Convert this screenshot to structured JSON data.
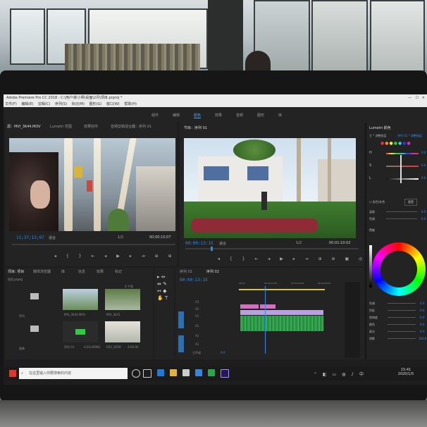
{
  "app": {
    "title_bar": "Adobe Premiere Pro CC 2018 - C:\\用户\\新小明\\桌面\\2月\\项目.prproj *",
    "menu": [
      "文件(F)",
      "编辑(E)",
      "剪辑(C)",
      "序列(S)",
      "标记(M)",
      "图形(G)",
      "窗口(W)",
      "帮助(H)"
    ]
  },
  "workspaces": [
    "组件",
    "编辑",
    "颜色",
    "效果",
    "音频",
    "图形",
    "库"
  ],
  "active_workspace": "颜色",
  "source_monitor": {
    "tabs": [
      "源：MVI_3644.MOV",
      "Lumetri 范围",
      "效果控件",
      "音频剪辑混合器：序列 01"
    ],
    "timecode": "11;37;13;07",
    "fit": "适合",
    "zoom": "1/2",
    "duration": "00;00;15;07"
  },
  "program_monitor": {
    "tab": "节目：序列 01",
    "timecode": "00:00:13:15",
    "fit": "适合",
    "zoom": "1/2",
    "duration": "00:01:10:02"
  },
  "project_panel": {
    "tabs": [
      "项目: 项目",
      "媒体浏览器",
      "库",
      "信息",
      "效果",
      "标记"
    ],
    "project_file": "项目.prproj",
    "item_count": "3 个项",
    "items": [
      {
        "name": "序列",
        "meta": ""
      },
      {
        "name": "MVI_3644.MOV",
        "meta": ""
      },
      {
        "name": "MVI_3641",
        "meta": ""
      },
      {
        "name": "图像",
        "meta": ""
      },
      {
        "name": "序列 01",
        "meta": "4;20;40960"
      },
      {
        "name": "DSC_0059",
        "meta": "4:00:00"
      }
    ]
  },
  "timeline": {
    "tabs": [
      "序列 01",
      "序列 02"
    ],
    "timecode": "00:00:13:15",
    "ruler": [
      "00:00",
      "00:00:15:00",
      "00:00:30:00",
      "00:00:45:00"
    ],
    "video_tracks": [
      "V3",
      "V2",
      "V1"
    ],
    "audio_tracks": [
      "A1",
      "A2",
      "A3"
    ],
    "master": "主声道",
    "master_value": "0.0"
  },
  "lumetri": {
    "title": "Lumetri 颜色",
    "master": "主 * 调整图层",
    "sequence": "序列 01 * 调整图层",
    "sections": [
      "色相/饱和度",
      "曲线",
      "色轮"
    ],
    "hsl_rows": [
      {
        "label": "H",
        "value": "0.0"
      },
      {
        "label": "S",
        "value": "0.0"
      },
      {
        "label": "L",
        "value": "0.0"
      }
    ],
    "secondary_label": "彩色/灰色",
    "secondary_button": "重置",
    "sliders": [
      {
        "label": "温度",
        "value": "0.0"
      },
      {
        "label": "色调",
        "value": "0.0"
      }
    ],
    "wheel_sliders": [
      {
        "label": "色调",
        "value": "0.0"
      },
      {
        "label": "色彩",
        "value": "0.0"
      },
      {
        "label": "饱和度",
        "value": "0.0"
      },
      {
        "label": "颜色",
        "value": "0.0"
      },
      {
        "label": "高光",
        "value": "0.0"
      },
      {
        "label": "阴影",
        "value": "100.0"
      }
    ],
    "reset_label": "重置"
  },
  "taskbar": {
    "search_placeholder": "在这里输入你要搜索的内容",
    "time": "15:41",
    "date": "2020/1/5"
  }
}
